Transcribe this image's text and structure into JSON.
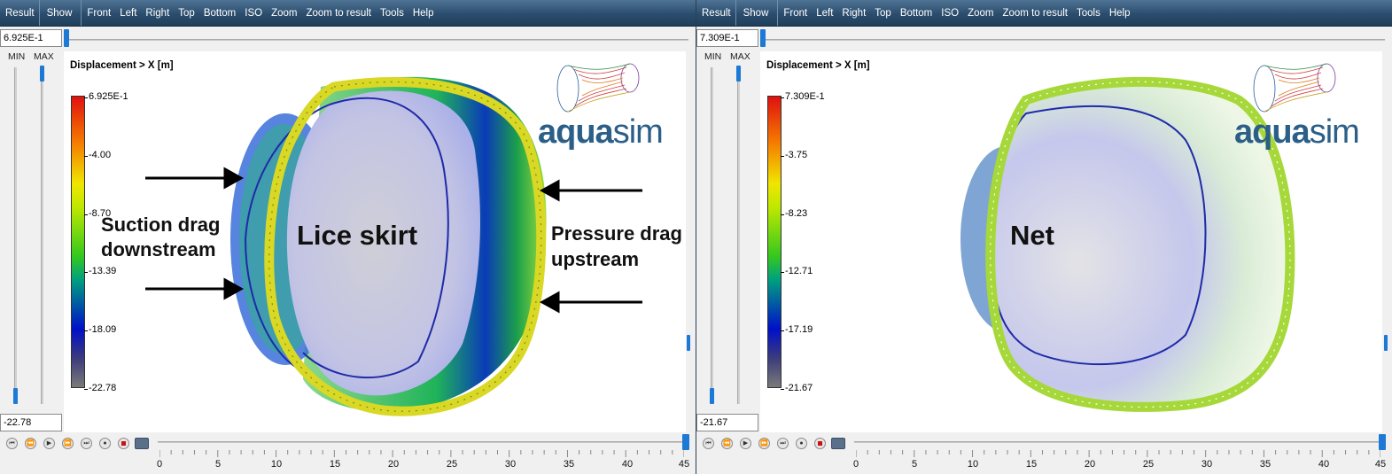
{
  "menu": {
    "items": [
      "Result",
      "Show",
      "Front",
      "Left",
      "Right",
      "Top",
      "Bottom",
      "ISO",
      "Zoom",
      "Zoom to result",
      "Tools",
      "Help"
    ]
  },
  "panels": [
    {
      "max_value": "6.925E-1",
      "min_value": "-22.78",
      "min_label": "MIN",
      "max_label": "MAX",
      "title": "Displacement > X [m]",
      "colorbar_ticks": [
        "6.925E-1",
        "-4.00",
        "-8.70",
        "-13.39",
        "-18.09",
        "-22.78"
      ],
      "logo": {
        "bold": "aqua",
        "light": "sim"
      },
      "labels": {
        "center": "Lice skirt",
        "left_1": "Suction drag",
        "left_2": "downstream",
        "right_1": "Pressure drag",
        "right_2": "upstream"
      },
      "timeline_ticks": [
        "0",
        "5",
        "10",
        "15",
        "20",
        "25",
        "30",
        "35",
        "40",
        "45"
      ],
      "colors": {
        "inner": "#b9bce6",
        "rim": "#d6e61e",
        "band": "#22b84a",
        "outline": "#1f2aa8"
      }
    },
    {
      "max_value": "7.309E-1",
      "min_value": "-21.67",
      "min_label": "MIN",
      "max_label": "MAX",
      "title": "Displacement > X [m]",
      "colorbar_ticks": [
        "7.309E-1",
        "-3.75",
        "-8.23",
        "-12.71",
        "-17.19",
        "-21.67"
      ],
      "logo": {
        "bold": "aqua",
        "light": "sim"
      },
      "labels": {
        "center": "Net"
      },
      "timeline_ticks": [
        "0",
        "5",
        "10",
        "15",
        "20",
        "25",
        "30",
        "35",
        "40",
        "45"
      ],
      "colors": {
        "inner": "#c0c3ea",
        "rim": "#b8e432",
        "band": "#e6f5d2",
        "outline": "#1f2aa8"
      }
    }
  ],
  "icons": [
    "skip-start-icon",
    "step-back-icon",
    "play-icon",
    "step-forward-icon",
    "skip-end-icon",
    "record-icon",
    "stop-icon",
    "camera-icon"
  ]
}
